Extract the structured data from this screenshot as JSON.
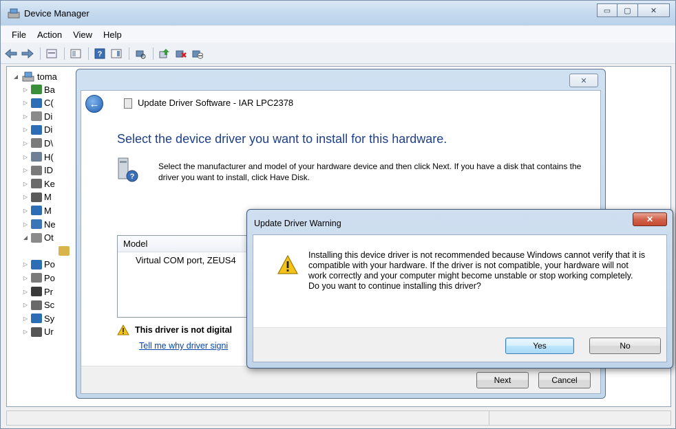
{
  "window": {
    "title": "Device Manager",
    "caption_buttons": {
      "minimize": "▭",
      "maximize": "▢",
      "close": "✕"
    }
  },
  "menu": [
    "File",
    "Action",
    "View",
    "Help"
  ],
  "toolbar": {
    "buttons": [
      "back-icon",
      "forward-icon",
      "properties-icon",
      "console-tree-icon",
      "help-icon",
      "show-hide-icon",
      "scan-hardware-icon",
      "update-driver-icon",
      "uninstall-icon",
      "disable-icon"
    ]
  },
  "tree": {
    "root_label": "toma",
    "rows": [
      {
        "label": "Ba",
        "icon": "battery-icon",
        "color": "#3a8f3a",
        "expander": "▷"
      },
      {
        "label": "C(",
        "icon": "computer-icon",
        "color": "#2d6db5",
        "expander": "▷"
      },
      {
        "label": "Di",
        "icon": "disk-drive-icon",
        "color": "#8a8a8a",
        "expander": "▷"
      },
      {
        "label": "Di",
        "icon": "display-adapter-icon",
        "color": "#2d6db5",
        "expander": "▷"
      },
      {
        "label": "D\\",
        "icon": "dvd-drive-icon",
        "color": "#7a7a7a",
        "expander": "▷"
      },
      {
        "label": "H(",
        "icon": "hid-icon",
        "color": "#6f7f94",
        "expander": "▷"
      },
      {
        "label": "ID",
        "icon": "ide-controller-icon",
        "color": "#7a7a7a",
        "expander": "▷"
      },
      {
        "label": "Ke",
        "icon": "keyboard-icon",
        "color": "#6a6a6a",
        "expander": "▷"
      },
      {
        "label": "M",
        "icon": "mouse-icon",
        "color": "#5a5a5a",
        "expander": "▷"
      },
      {
        "label": "M",
        "icon": "monitor-icon",
        "color": "#2d6db5",
        "expander": "▷"
      },
      {
        "label": "Ne",
        "icon": "network-adapter-icon",
        "color": "#3c74b8",
        "expander": "▷"
      },
      {
        "label": "Ot",
        "icon": "other-devices-icon",
        "color": "#8a8a8a",
        "expander": "◢"
      },
      {
        "label": "",
        "icon": "unknown-device-icon",
        "color": "#d9b44a",
        "expander": ""
      },
      {
        "label": "Po",
        "icon": "portable-device-icon",
        "color": "#2d6db5",
        "expander": "▷"
      },
      {
        "label": "Po",
        "icon": "ports-icon",
        "color": "#7a7a7a",
        "expander": "▷"
      },
      {
        "label": "Pr",
        "icon": "processor-icon",
        "color": "#3a3a3a",
        "expander": "▷"
      },
      {
        "label": "Sc",
        "icon": "sound-icon",
        "color": "#6a6a6a",
        "expander": "▷"
      },
      {
        "label": "Sy",
        "icon": "system-devices-icon",
        "color": "#2d6db5",
        "expander": "▷"
      },
      {
        "label": "Ur",
        "icon": "usb-controller-icon",
        "color": "#555555",
        "expander": "▷"
      }
    ]
  },
  "wizard": {
    "title": "Update Driver Software - IAR LPC2378",
    "close_label": "✕",
    "heading": "Select the device driver you want to install for this hardware.",
    "description": "Select the manufacturer and model of your hardware device and then click Next. If you have a disk that contains the driver you want to install, click Have Disk.",
    "model_header": "Model",
    "model_item": "Virtual COM port, ZEUS4",
    "warning_text": "This driver is not digital",
    "warning_link": "Tell me why driver signi",
    "next_label": "Next",
    "cancel_label": "Cancel"
  },
  "warning_dialog": {
    "title": "Update Driver Warning",
    "close_label": "✕",
    "message": "Installing this device driver is not recommended because Windows cannot verify that it is compatible with your hardware.  If the driver is not compatible, your hardware will not work correctly and your computer might become unstable or stop working completely.  Do you want to continue installing this driver?",
    "yes_label": "Yes",
    "no_label": "No"
  },
  "colors": {
    "heading_blue": "#1e3f8a",
    "link_blue": "#0645ad",
    "close_red": "#c64a30",
    "warning_yellow": "#f3c31c"
  }
}
